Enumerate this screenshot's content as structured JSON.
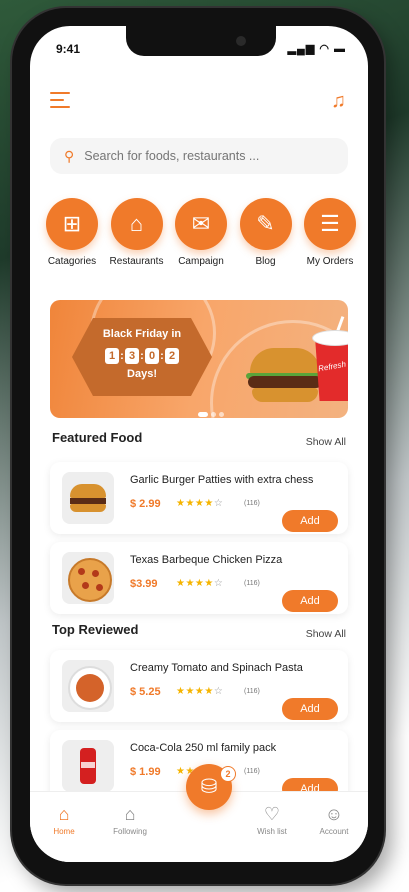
{
  "status": {
    "time": "9:41",
    "icons": "▂▄▆ ◠ ▬"
  },
  "search": {
    "placeholder": "Search for foods, restaurants ..."
  },
  "categories": [
    {
      "label": "Catagories",
      "icon": "grid-icon",
      "glyph": "⊞"
    },
    {
      "label": "Restaurants",
      "icon": "store-icon",
      "glyph": "⌂"
    },
    {
      "label": "Campaign",
      "icon": "megaphone-icon",
      "glyph": "✉"
    },
    {
      "label": "Blog",
      "icon": "chat-icon",
      "glyph": "✎"
    },
    {
      "label": "My Orders",
      "icon": "document-icon",
      "glyph": "☰"
    }
  ],
  "banner": {
    "title": "Black Friday in",
    "digits": [
      "1",
      "3",
      "0",
      "2"
    ],
    "days": "Days!",
    "cup_brand": "Refresh"
  },
  "featured": {
    "title": "Featured Food",
    "show_all": "Show All",
    "items": [
      {
        "name": "Garlic Burger Patties with extra chess",
        "price": "$ 2.99",
        "stars": "★★★★",
        "empty": "☆",
        "count": "(116)",
        "add": "Add"
      },
      {
        "name": "Texas Barbeque Chicken Pizza",
        "price": "$3.99",
        "stars": "★★★★",
        "empty": "☆",
        "count": "(116)",
        "add": "Add"
      }
    ]
  },
  "top_reviewed": {
    "title": "Top Reviewed",
    "show_all": "Show All",
    "items": [
      {
        "name": "Creamy Tomato and Spinach Pasta",
        "price": "$ 5.25",
        "stars": "★★★★",
        "empty": "☆",
        "count": "(116)",
        "add": "Add"
      },
      {
        "name": "Coca-Cola 250 ml family pack",
        "price": "$ 1.99",
        "stars": "★★★★",
        "empty": "☆",
        "count": "(116)",
        "add": "Add"
      }
    ]
  },
  "nav": {
    "home": "Home",
    "following": "Following",
    "wishlist": "Wish list",
    "account": "Account",
    "cart_count": "2"
  },
  "colors": {
    "accent": "#f07a2a",
    "star": "#f5b400"
  }
}
